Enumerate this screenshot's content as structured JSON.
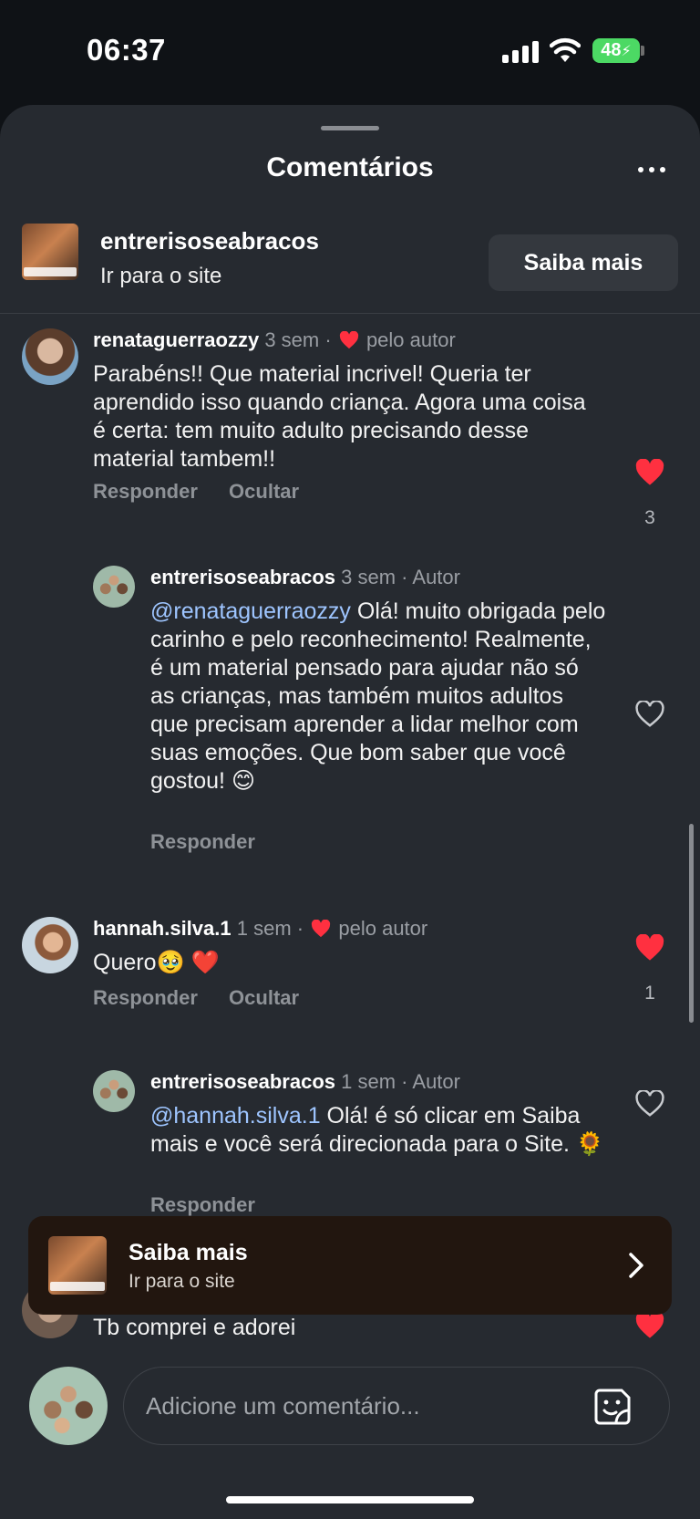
{
  "status_bar": {
    "time": "06:37",
    "battery": "48"
  },
  "sheet": {
    "title": "Comentários"
  },
  "ad": {
    "account": "entrerisoseabracos",
    "subtitle": "Ir para o site",
    "cta": "Saiba mais"
  },
  "comments": [
    {
      "username": "renataguerraozzy",
      "time": "3 sem",
      "sep": "·",
      "liked_by_author": "pelo autor",
      "text": "Parabéns!! Que material incrivel! Queria ter aprendido isso quando criança. Agora uma coisa é certa: tem muito adulto precisando desse material tambem!!",
      "like_count": "3",
      "actions": [
        "Responder",
        "Ocultar"
      ]
    },
    {
      "username": "entrerisoseabracos",
      "time": "3 sem",
      "role": "· Autor",
      "mention": "@renataguerraozzy",
      "text": " Olá! muito obrigada pelo carinho e pelo reconhecimento! Realmente, é um material pensado para ajudar não só as crianças, mas também muitos adultos que precisam aprender a lidar melhor com suas emoções. Que bom saber que você gostou! 😊",
      "actions": [
        "Responder"
      ]
    },
    {
      "username": "hannah.silva.1",
      "time": "1 sem",
      "sep": "·",
      "liked_by_author": "pelo autor",
      "text": "Quero🥹 ❤️",
      "like_count": "1",
      "actions": [
        "Responder",
        "Ocultar"
      ]
    },
    {
      "username": "entrerisoseabracos",
      "time": "1 sem",
      "role": "· Autor",
      "mention": "@hannah.silva.1",
      "text": " Olá! é só clicar em Saiba mais e você será direcionada para o Site. 🌻",
      "actions": [
        "Responder"
      ]
    },
    {
      "text": "Tb comprei e adorei"
    }
  ],
  "promo": {
    "title": "Saiba mais",
    "subtitle": "Ir para o site"
  },
  "composer": {
    "placeholder": "Adicione um comentário..."
  },
  "colors": {
    "like_red": "#ff3040",
    "mention_blue": "#9ec5ff",
    "sheet_bg": "#262a30"
  },
  "icons": [
    "more-horizontal-icon",
    "heart-filled-icon",
    "heart-outline-icon",
    "chevron-right-icon",
    "sticker-icon",
    "wifi-icon",
    "signal-icon",
    "battery-icon"
  ]
}
